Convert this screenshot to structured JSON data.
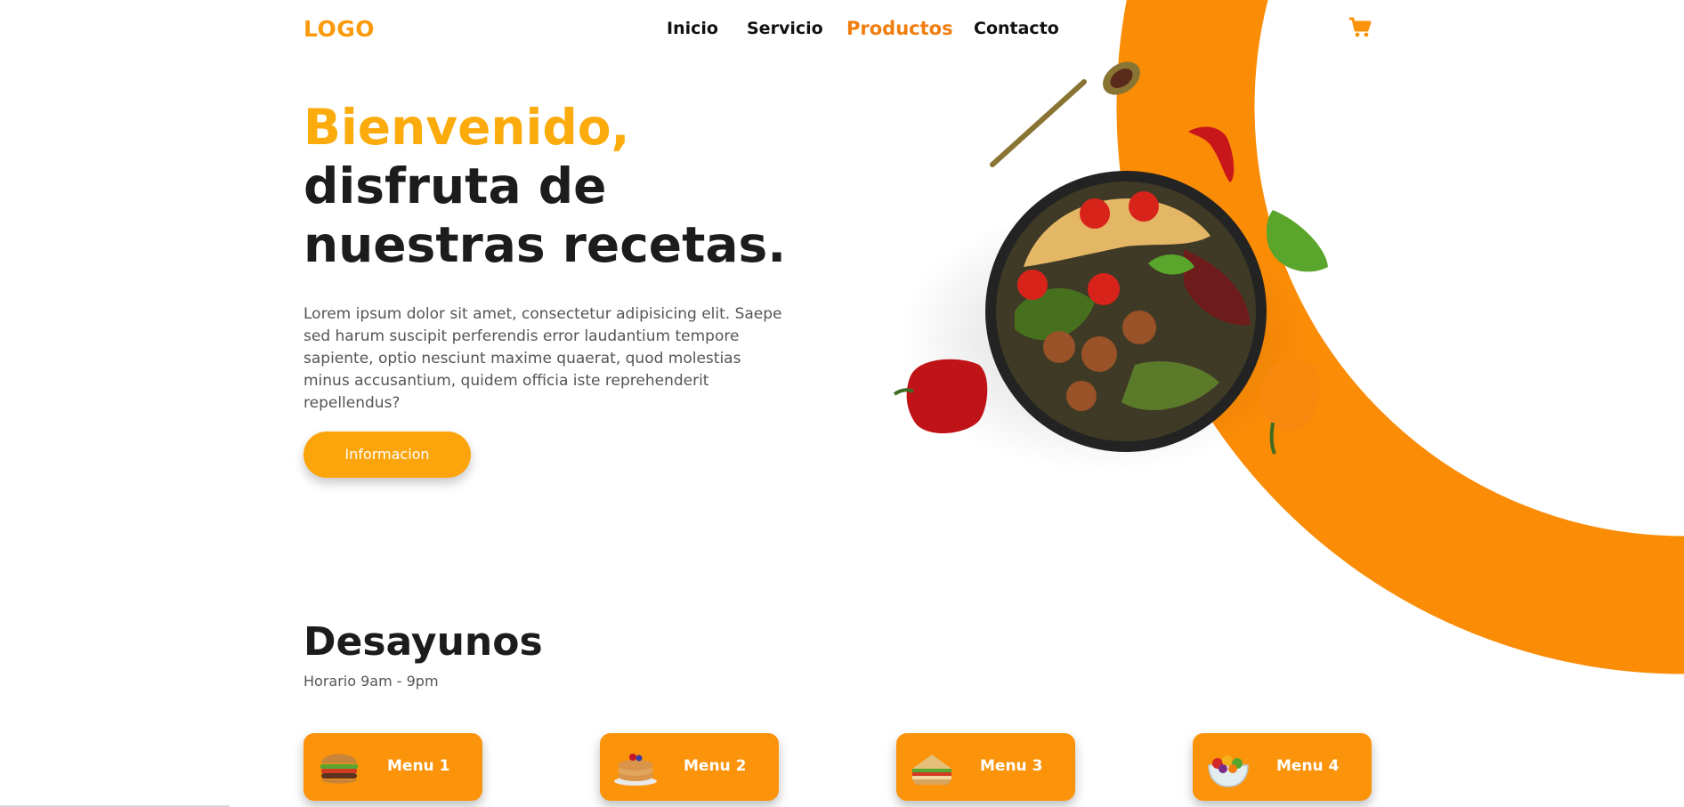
{
  "header": {
    "logo": "LOGO",
    "nav": [
      "Inicio",
      "Servicio",
      "Productos",
      "Contacto"
    ],
    "active_nav": "Productos",
    "cart_icon": "shopping-cart-icon"
  },
  "hero": {
    "title_accent": "Bienvenido,",
    "title_line2": "disfruta de",
    "title_line3": "nuestras recetas.",
    "description": "Lorem ipsum dolor sit amet, consectetur adipisicing elit. Saepe sed harum suscipit perferendis error laudantium tempore sapiente, optio nesciunt maxime quaerat, quod molestias minus accusantium, quidem officia iste reprehenderit repellendus?",
    "button": "Informacion"
  },
  "section": {
    "title": "Desayunos",
    "subtitle": "Horario 9am - 9pm",
    "menus": [
      {
        "label": "Menu 1",
        "icon": "burger-icon"
      },
      {
        "label": "Menu 2",
        "icon": "pancakes-icon"
      },
      {
        "label": "Menu 3",
        "icon": "sandwich-icon"
      },
      {
        "label": "Menu 4",
        "icon": "fruit-salad-icon"
      }
    ]
  },
  "colors": {
    "accent_orange": "#fb930b",
    "title_yellow": "#fbab0b",
    "active_nav": "#f07d0e",
    "text_dark": "#1c1c1c"
  }
}
